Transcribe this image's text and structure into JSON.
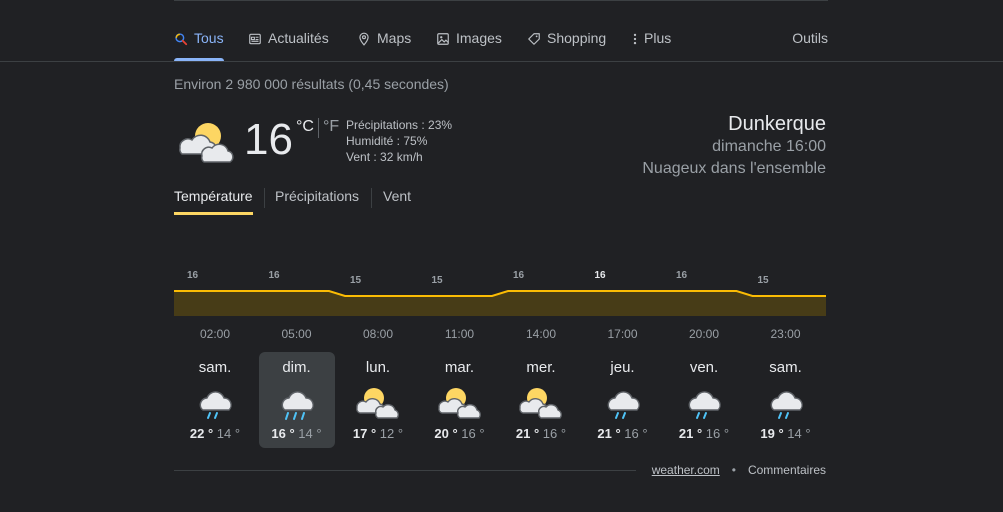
{
  "nav": {
    "items": [
      {
        "label": "Tous",
        "icon": "search-icon"
      },
      {
        "label": "Actualités",
        "icon": "news-icon"
      },
      {
        "label": "Maps",
        "icon": "map-pin-icon"
      },
      {
        "label": "Images",
        "icon": "image-icon"
      },
      {
        "label": "Shopping",
        "icon": "tag-icon"
      },
      {
        "label": "Plus",
        "icon": "more-vert-icon"
      }
    ],
    "tools": "Outils"
  },
  "stats": "Environ 2 980 000 résultats (0,45 secondes)",
  "current": {
    "temp": "16",
    "unit_c": "°C",
    "unit_f": "°F",
    "precip": "Précipitations : 23%",
    "humidity": "Humidité : 75%",
    "wind": "Vent : 32 km/h",
    "icon": "partly-cloudy-icon"
  },
  "location": {
    "city": "Dunkerque",
    "when": "dimanche 16:00",
    "condition": "Nuageux dans l'ensemble"
  },
  "tabs": [
    "Température",
    "Précipitations",
    "Vent"
  ],
  "chart_data": {
    "type": "area",
    "x": [
      "02:00",
      "05:00",
      "08:00",
      "11:00",
      "14:00",
      "17:00",
      "20:00",
      "23:00"
    ],
    "series": [
      {
        "values": [
          16,
          16,
          15,
          15,
          16,
          16,
          16,
          15
        ]
      }
    ],
    "labels": [
      "16",
      "16",
      "15",
      "15",
      "16",
      "16",
      "16",
      "15"
    ],
    "highlight_index": 5,
    "colors": {
      "line": "#fbbc04",
      "fill": "#473c17"
    }
  },
  "days": [
    {
      "name": "sam.",
      "hi": "22",
      "lo": "14",
      "icon": "rain-icon"
    },
    {
      "name": "dim.",
      "hi": "16",
      "lo": "14",
      "icon": "heavy-rain-icon"
    },
    {
      "name": "lun.",
      "hi": "17",
      "lo": "12",
      "icon": "partly-cloudy-icon"
    },
    {
      "name": "mar.",
      "hi": "20",
      "lo": "16",
      "icon": "partly-cloudy-icon"
    },
    {
      "name": "mer.",
      "hi": "21",
      "lo": "16",
      "icon": "partly-cloudy-icon"
    },
    {
      "name": "jeu.",
      "hi": "21",
      "lo": "16",
      "icon": "rain-icon"
    },
    {
      "name": "ven.",
      "hi": "21",
      "lo": "16",
      "icon": "rain-icon"
    },
    {
      "name": "sam.",
      "hi": "19",
      "lo": "14",
      "icon": "rain-icon"
    }
  ],
  "degree": "°",
  "footer": {
    "source": "weather.com",
    "dot": "•",
    "feedback": "Commentaires"
  }
}
